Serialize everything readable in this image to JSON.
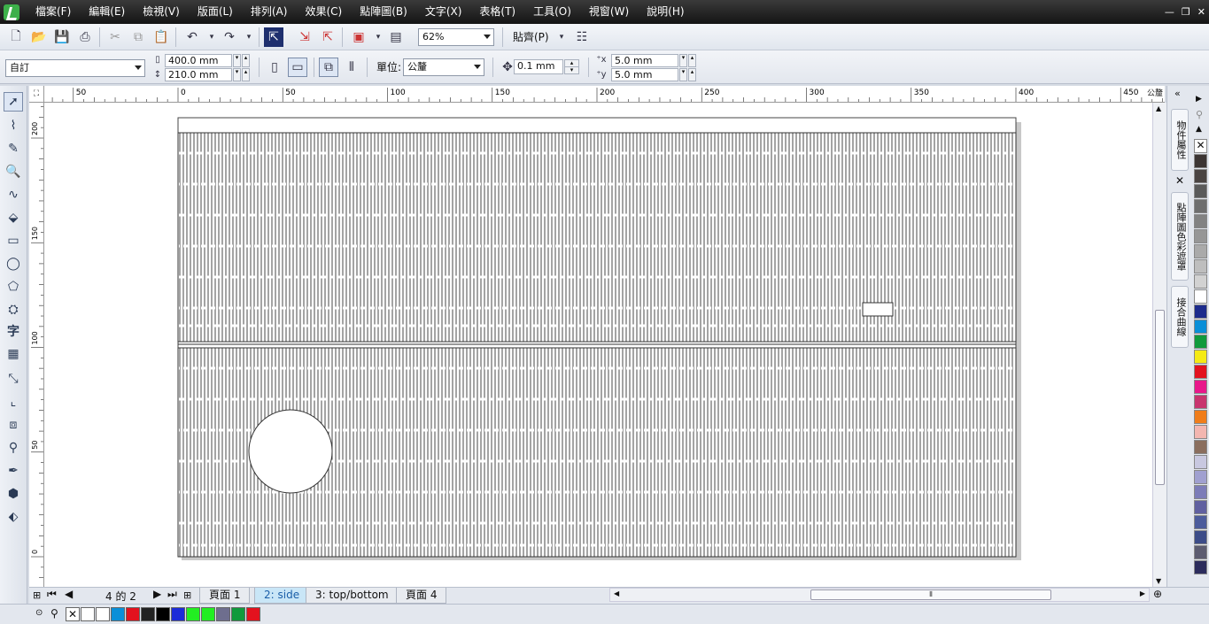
{
  "menu": [
    "檔案(F)",
    "編輯(E)",
    "檢視(V)",
    "版面(L)",
    "排列(A)",
    "效果(C)",
    "點陣圖(B)",
    "文字(X)",
    "表格(T)",
    "工具(O)",
    "視窗(W)",
    "說明(H)"
  ],
  "toolbar": {
    "zoom": "62%",
    "snap": "貼齊(P)"
  },
  "property_bar": {
    "paper_preset": "自訂",
    "width": "400.0 mm",
    "height": "210.0 mm",
    "units_label": "單位:",
    "units": "公釐",
    "nudge": "0.1 mm",
    "dup_x": "5.0 mm",
    "dup_y": "5.0 mm"
  },
  "ruler": {
    "unit": "公釐",
    "h_labels": [
      "50",
      "0",
      "50",
      "100",
      "150",
      "200",
      "250",
      "300",
      "350",
      "400",
      "450"
    ],
    "v_labels": [
      "200",
      "150",
      "100",
      "50",
      "0"
    ]
  },
  "dockers": [
    "物件屬性",
    "點陣圖色彩遮罩",
    "接合曲線"
  ],
  "pages": {
    "counter": "4 的 2",
    "tabs": [
      "頁面 1",
      "2: side",
      "3: top/bottom",
      "頁面 4"
    ],
    "active": 1
  },
  "palette_v": [
    "#3c3533",
    "#4a4442",
    "#5a5a5a",
    "#6e6e6e",
    "#828282",
    "#969696",
    "#aaaaaa",
    "#bebebe",
    "#d2d2d2",
    "#ffffff",
    "#1c2b8c",
    "#0a8fd8",
    "#109a3c",
    "#f5ea14",
    "#e3121e",
    "#e8178a",
    "#c8346e",
    "#f07d1a",
    "#f3b6b0",
    "#8a6e5e",
    "#c8c8e0",
    "#a0a0d0",
    "#7c7cb8",
    "#6060a0",
    "#4c5c9c",
    "#3c4c88",
    "#5c5c70",
    "#2c2c5c"
  ],
  "palette_h": [
    "#ffffff",
    "#ffffff",
    "#0a8fd8",
    "#e3121e",
    "#222222",
    "#000000",
    "#1c2bd8",
    "#22ee22",
    "#22ee22",
    "#6e6e8e",
    "#109a3c",
    "#e3121e"
  ]
}
